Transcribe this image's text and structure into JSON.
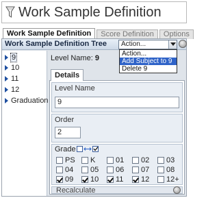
{
  "window": {
    "title": "Work Sample Definition",
    "icon": "filter-funnel-icon"
  },
  "tabs": [
    {
      "label": "Work Sample Definition",
      "active": true
    },
    {
      "label": "Score Definition",
      "active": false
    },
    {
      "label": "Options",
      "active": false
    }
  ],
  "tree_panel": {
    "title": "Work Sample Definition Tree",
    "action_select": {
      "value": "Action..."
    },
    "dropdown_options": [
      {
        "label": "Action...",
        "highlighted": false
      },
      {
        "label": "Add Subject to 9",
        "highlighted": true
      },
      {
        "label": "Delete 9",
        "highlighted": false
      }
    ],
    "items": [
      {
        "label": "9",
        "selected": true
      },
      {
        "label": "10",
        "selected": false
      },
      {
        "label": "11",
        "selected": false
      },
      {
        "label": "12",
        "selected": false
      },
      {
        "label": "Graduation",
        "selected": false
      }
    ]
  },
  "detail": {
    "level_name_caption": "Level Name:",
    "level_name_value": "9",
    "details_tab": "Details",
    "level_name_field": {
      "label": "Level Name",
      "value": "9"
    },
    "order_field": {
      "label": "Order",
      "value": "2"
    },
    "grade": {
      "label": "Grade",
      "icon": "grade-transfer-icon",
      "options": [
        {
          "label": "PS",
          "checked": false
        },
        {
          "label": "K",
          "checked": false
        },
        {
          "label": "01",
          "checked": false
        },
        {
          "label": "02",
          "checked": false
        },
        {
          "label": "03",
          "checked": false
        },
        {
          "label": "04",
          "checked": false
        },
        {
          "label": "05",
          "checked": false
        },
        {
          "label": "06",
          "checked": false
        },
        {
          "label": "07",
          "checked": false
        },
        {
          "label": "08",
          "checked": false
        },
        {
          "label": "09",
          "checked": true
        },
        {
          "label": "10",
          "checked": true
        },
        {
          "label": "11",
          "checked": true
        },
        {
          "label": "12",
          "checked": true
        },
        {
          "label": "12+",
          "checked": false
        }
      ]
    },
    "recalculate_label": "Recalculate"
  }
}
